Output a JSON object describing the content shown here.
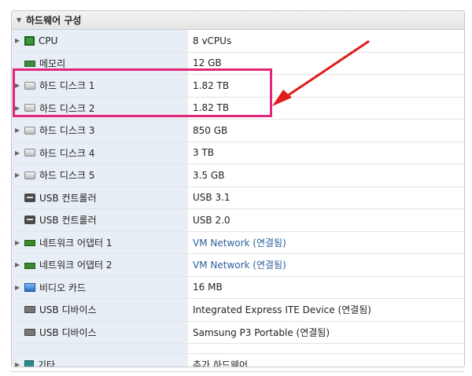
{
  "panel": {
    "title": "하드웨어 구성"
  },
  "rows": [
    {
      "name": "CPU",
      "value": "8 vCPUs",
      "icon": "cpu-icon",
      "expand": true
    },
    {
      "name": "메모리",
      "value": "12 GB",
      "icon": "memory-icon",
      "expand": false
    },
    {
      "name": "하드 디스크 1",
      "value": "1.82 TB",
      "icon": "hard-disk-icon",
      "expand": true
    },
    {
      "name": "하드 디스크 2",
      "value": "1.82 TB",
      "icon": "hard-disk-icon",
      "expand": true
    },
    {
      "name": "하드 디스크 3",
      "value": "850 GB",
      "icon": "hard-disk-icon",
      "expand": true
    },
    {
      "name": "하드 디스크 4",
      "value": "3 TB",
      "icon": "hard-disk-icon",
      "expand": true
    },
    {
      "name": "하드 디스크 5",
      "value": "3.5 GB",
      "icon": "hard-disk-icon",
      "expand": true
    },
    {
      "name": "USB 컨트롤러",
      "value": "USB 3.1",
      "icon": "usb-controller-icon",
      "expand": false
    },
    {
      "name": "USB 컨트롤러",
      "value": "USB 2.0",
      "icon": "usb-controller-icon",
      "expand": false
    },
    {
      "name": "네트워크 어댑터 1",
      "value": "VM Network (연결됨)",
      "icon": "network-adapter-icon",
      "expand": true
    },
    {
      "name": "네트워크 어댑터 2",
      "value": "VM Network (연결됨)",
      "icon": "network-adapter-icon",
      "expand": true
    },
    {
      "name": "비디오 카드",
      "value": "16 MB",
      "icon": "video-card-icon",
      "expand": true
    },
    {
      "name": "USB 디바이스",
      "value": "Integrated Express ITE Device (연결됨)",
      "icon": "usb-device-icon",
      "expand": false
    },
    {
      "name": "USB 디바이스",
      "value": "Samsung P3 Portable (연결됨)",
      "icon": "usb-device-icon",
      "expand": false
    }
  ],
  "other": {
    "name": "기타",
    "value": "추가 하드웨어",
    "icon": "other-icon"
  },
  "colors": {
    "highlight": "#e2267a",
    "arrow": "#e01b1b",
    "name_column_bg": "#e8eef5",
    "link": "#2a5f9e"
  }
}
